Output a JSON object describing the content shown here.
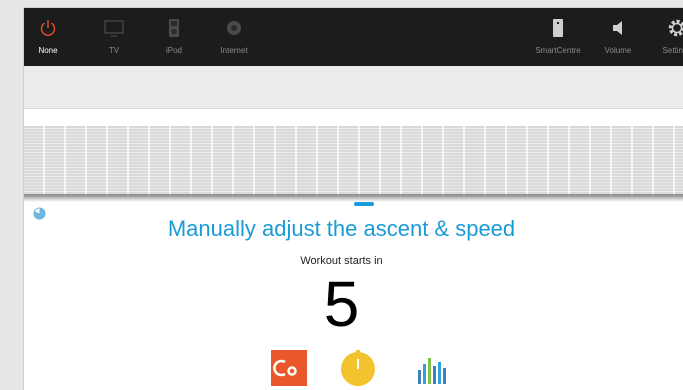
{
  "nav": {
    "items": [
      {
        "label": "None",
        "icon": "power-icon",
        "active": true
      },
      {
        "label": "TV",
        "icon": "tv-icon",
        "active": false
      },
      {
        "label": "iPod",
        "icon": "ipod-icon",
        "active": false
      },
      {
        "label": "Internet",
        "icon": "globe-icon",
        "active": false
      }
    ],
    "right_items": [
      {
        "label": "SmartCentre",
        "icon": "phone-icon"
      },
      {
        "label": "Volume",
        "icon": "speaker-icon"
      },
      {
        "label": "Settings",
        "icon": "gear-icon"
      }
    ]
  },
  "workout": {
    "headline": "Manually adjust the ascent & speed",
    "subtext": "Workout starts in",
    "countdown": "5"
  },
  "colors": {
    "accent": "#1a9bd7",
    "power_active": "#e8512b",
    "badge_orange": "#e8582a",
    "badge_yellow": "#f2c32c"
  }
}
